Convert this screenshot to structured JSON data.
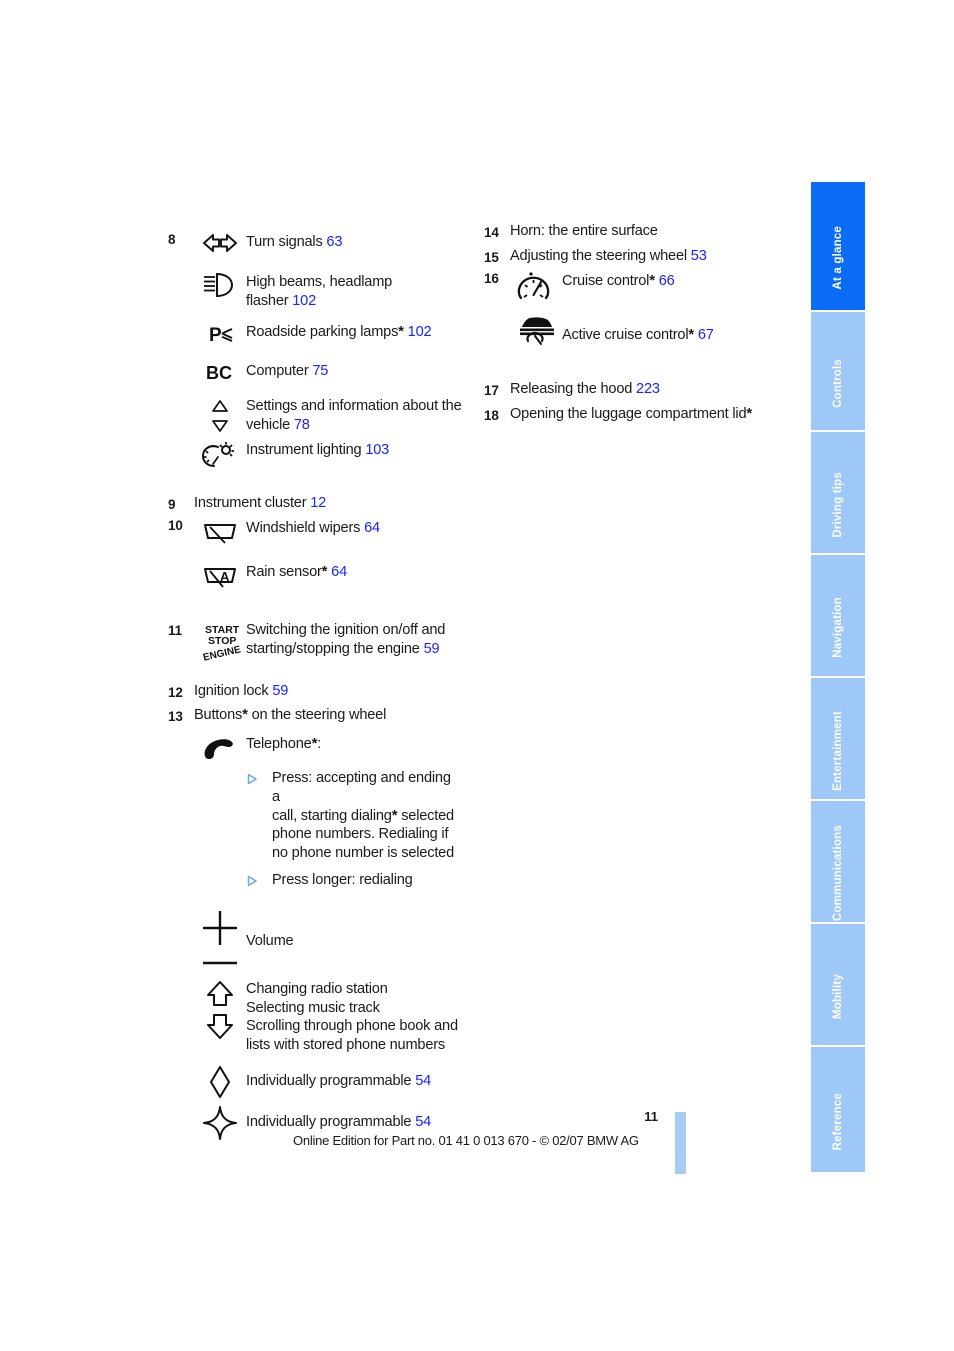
{
  "page": {
    "number": "11",
    "footer": "Online Edition for Part no. 01 41 0 013 670 - © 02/07 BMW AG"
  },
  "sidebar": {
    "tabs": [
      {
        "label": "At a glance",
        "active": true
      },
      {
        "label": "Controls",
        "active": false
      },
      {
        "label": "Driving tips",
        "active": false
      },
      {
        "label": "Navigation",
        "active": false
      },
      {
        "label": "Entertainment",
        "active": false
      },
      {
        "label": "Communications",
        "active": false
      },
      {
        "label": "Mobility",
        "active": false
      },
      {
        "label": "Reference",
        "active": false
      }
    ],
    "colors": {
      "active": "#0b6cf7",
      "inactive": "#9ec8f7"
    }
  },
  "colors": {
    "page_reference": "#1823ff",
    "bullet": "#6fa8e8",
    "text": "#1a1a1a"
  },
  "left_column": {
    "item8": {
      "number": "8",
      "entries": [
        {
          "icon": "turn-signals-icon",
          "label": "Turn signals",
          "page": "63"
        },
        {
          "icon": "high-beam-icon",
          "label": "High beams, headlamp flasher",
          "page": "102"
        },
        {
          "icon": "roadside-parking-lamps-icon",
          "label": "Roadside parking lamps",
          "star": "*",
          "page": "102"
        },
        {
          "icon": "computer-bc-icon",
          "label": "Computer",
          "page": "75"
        },
        {
          "icon": "up-down-triangles-icon",
          "label": "Settings and information about the vehicle",
          "page": "78"
        },
        {
          "icon": "instrument-lighting-icon",
          "label": "Instrument lighting",
          "page": "103"
        }
      ]
    },
    "item9": {
      "number": "9",
      "label": "Instrument cluster",
      "page": "12"
    },
    "item10": {
      "number": "10",
      "entries": [
        {
          "icon": "windshield-wipers-icon",
          "label": "Windshield wipers",
          "page": "64"
        },
        {
          "icon": "rain-sensor-icon",
          "label": "Rain sensor",
          "star": "*",
          "page": "64"
        }
      ]
    },
    "item11": {
      "number": "11",
      "icon": "start-stop-engine-icon",
      "label": "Switching the ignition on/off and starting/stopping the engine",
      "page": "59"
    },
    "item12": {
      "number": "12",
      "label": "Ignition lock",
      "page": "59"
    },
    "item13": {
      "number": "13",
      "label_before": "Buttons",
      "star": "*",
      "label_after": " on the steering wheel",
      "telephone": {
        "icon": "telephone-icon",
        "heading_before": "Telephone",
        "heading_star": "*",
        "heading_after": ":",
        "bullets": [
          "Press: accepting and ending a call, starting dialing* selected phone numbers. Redialing if no phone number is selected",
          "Press longer: redialing"
        ]
      },
      "volume": {
        "icon": "volume-plus-minus-icon",
        "label": "Volume"
      },
      "scroll": {
        "icon": "up-down-arrows-icon",
        "lines": [
          "Changing radio station",
          "Selecting music track",
          "Scrolling through phone book and",
          "lists with stored phone numbers"
        ]
      },
      "programmable1": {
        "icon": "diamond-icon",
        "label": "Individually programmable",
        "page": "54"
      },
      "programmable2": {
        "icon": "four-point-star-icon",
        "label": "Individually programmable",
        "page": "54"
      }
    }
  },
  "right_column": {
    "item14": {
      "number": "14",
      "label": "Horn: the entire surface"
    },
    "item15": {
      "number": "15",
      "label": "Adjusting the steering wheel",
      "page": "53"
    },
    "item16": {
      "number": "16",
      "entries": [
        {
          "icon": "cruise-control-icon",
          "label": "Cruise control",
          "star": "*",
          "page": "66"
        },
        {
          "icon": "active-cruise-control-icon",
          "label": "Active cruise control",
          "star": "*",
          "page": "67"
        }
      ]
    },
    "item17": {
      "number": "17",
      "label": "Releasing the hood",
      "page": "223"
    },
    "item18": {
      "number": "18",
      "label_before": "Opening the luggage compartment lid",
      "star": "*"
    }
  }
}
